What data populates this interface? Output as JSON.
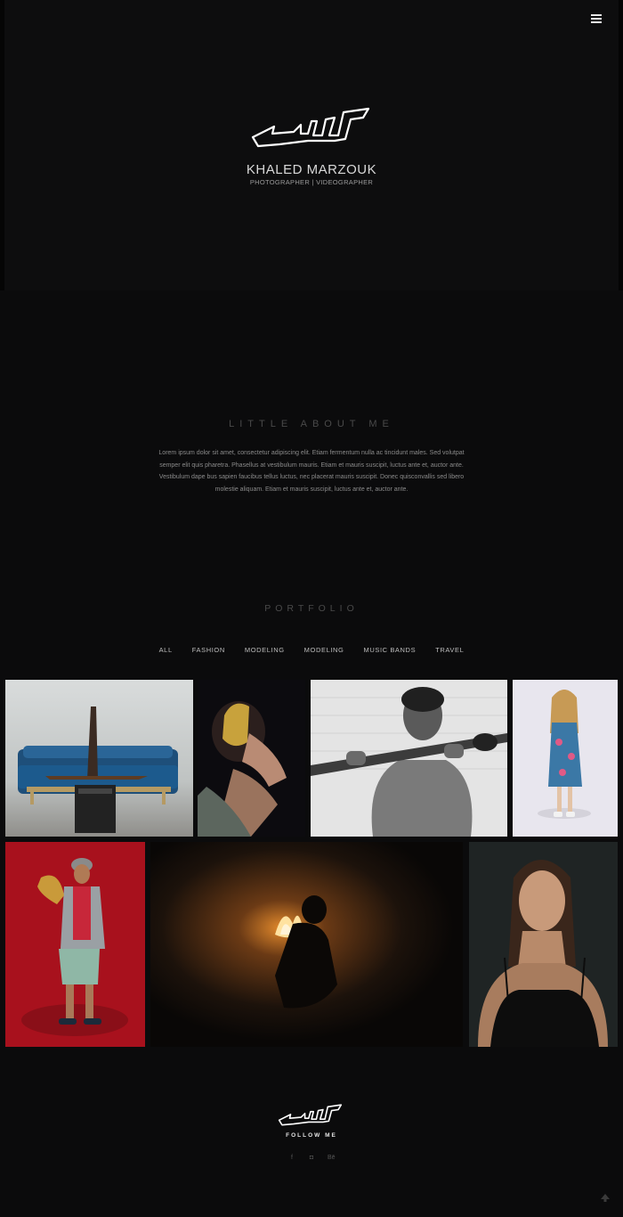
{
  "header": {
    "menu_icon": "hamburger-menu-icon",
    "brand_name": "KHALED MARZOUK",
    "brand_subtitle": "PHOTOGRAPHER | VIDEOGRAPHER"
  },
  "about": {
    "title": "LITTLE ABOUT ME",
    "text": "Lorem ipsum dolor sit amet, consectetur adipiscing elit. Etiam fermentum nulla ac tincidunt males. Sed volutpat semper elit quis pharetra. Phasellus at vestibulum mauris. Etiam et mauris suscipit, luctus ante et, auctor ante. Vestibulum dape bus sapien faucibus tellus luctus, nec placerat mauris suscipit. Donec quisconvallis sed libero molestie aliquam. Etiam et mauris suscipit, luctus ante et, auctor ante."
  },
  "portfolio": {
    "title": "PORTFOLIO",
    "filters": [
      "ALL",
      "FASHION",
      "MODELING",
      "MODELING",
      "MUSIC BANDS",
      "TRAVEL"
    ],
    "items": [
      {
        "name": "sofa-pose-photo"
      },
      {
        "name": "golden-headpiece-portrait"
      },
      {
        "name": "shirtless-man-bw-portrait"
      },
      {
        "name": "girl-floral-dress-photo"
      },
      {
        "name": "saxophone-player-red-photo"
      },
      {
        "name": "campfire-silhouette-photo"
      },
      {
        "name": "woman-dark-portrait"
      }
    ]
  },
  "footer": {
    "follow_label": "FOLLOW ME",
    "socials": [
      {
        "icon": "facebook-icon",
        "glyph": "f"
      },
      {
        "icon": "instagram-icon",
        "glyph": "◘"
      },
      {
        "icon": "behance-icon",
        "glyph": "Bē"
      }
    ],
    "back_to_top_icon": "arrow-up-icon"
  },
  "colors": {
    "background": "#0b0b0c",
    "accent_red": "#b3121e"
  }
}
